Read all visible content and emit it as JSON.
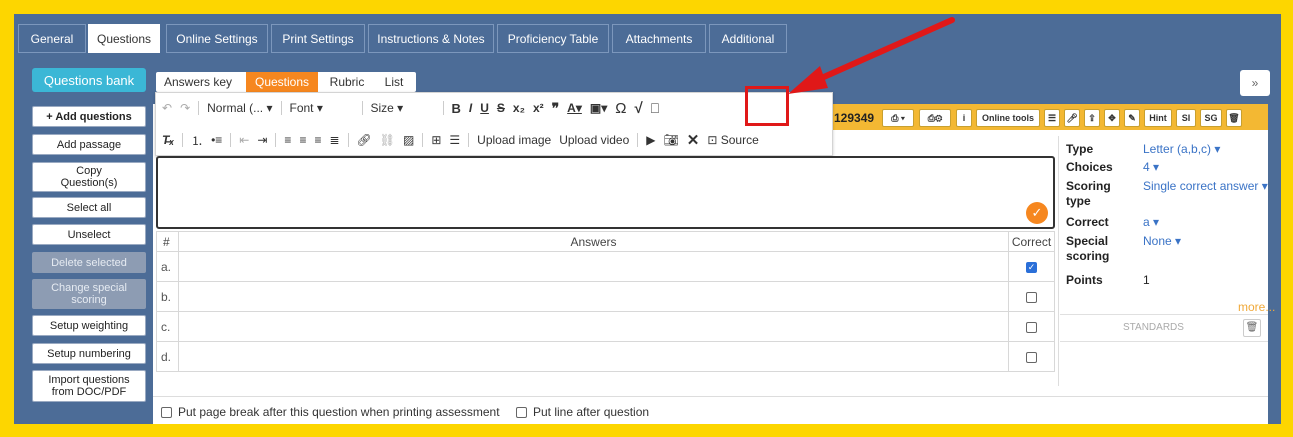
{
  "top_tabs": [
    {
      "label": "General",
      "active": false
    },
    {
      "label": "Questions",
      "active": true
    },
    {
      "label": "Online Settings",
      "active": false
    },
    {
      "label": "Print Settings",
      "active": false
    },
    {
      "label": "Instructions & Notes",
      "active": false
    },
    {
      "label": "Proficiency Table",
      "active": false
    },
    {
      "label": "Attachments",
      "active": false
    },
    {
      "label": "Additional",
      "active": false
    }
  ],
  "sidebar": {
    "questions_bank": "Questions bank",
    "buttons": [
      {
        "label": "+ Add questions",
        "disabled": false
      },
      {
        "label": "Add passage",
        "disabled": false
      },
      {
        "label": "Copy Question(s)",
        "disabled": false
      },
      {
        "label": "Select all",
        "disabled": false
      },
      {
        "label": "Unselect",
        "disabled": false
      },
      {
        "label": "Delete selected",
        "disabled": true
      },
      {
        "label": "Change special scoring",
        "disabled": true
      },
      {
        "label": "Setup weighting",
        "disabled": false
      },
      {
        "label": "Setup numbering",
        "disabled": false
      },
      {
        "label": "Import questions from DOC/PDF",
        "disabled": false
      }
    ]
  },
  "sub_tabs": [
    {
      "label": "Answers key",
      "active": false
    },
    {
      "label": "Questions",
      "active": true
    },
    {
      "label": "Rubric",
      "active": false
    },
    {
      "label": "List",
      "active": false
    }
  ],
  "expand_icon": "»",
  "editor_toolbar": {
    "paragraph_format": "Normal (...",
    "font": "Font",
    "size": "Size",
    "upload_image": "Upload image",
    "upload_video": "Upload video",
    "source": "Source"
  },
  "question": {
    "id_suffix": "129349",
    "tools": [
      "Online tools",
      "Hint",
      "SI",
      "SG"
    ]
  },
  "answers_table": {
    "headers": {
      "num": "#",
      "answers": "Answers",
      "correct": "Correct"
    },
    "rows": [
      {
        "letter": "a.",
        "text": "",
        "correct": true
      },
      {
        "letter": "b.",
        "text": "",
        "correct": false
      },
      {
        "letter": "c.",
        "text": "",
        "correct": false
      },
      {
        "letter": "d.",
        "text": "",
        "correct": false
      }
    ]
  },
  "properties": {
    "type_label": "Type",
    "type_value": "Letter (a,b,c)",
    "choices_label": "Choices",
    "choices_value": "4",
    "scoring_label": "Scoring type",
    "scoring_value": "Single correct answer",
    "correct_label": "Correct",
    "correct_value": "a",
    "special_label": "Special scoring",
    "special_value": "None",
    "points_label": "Points",
    "points_value": "1",
    "more": "more...",
    "standards": "STANDARDS"
  },
  "footer": {
    "page_break": "Put page break after this question when printing assessment",
    "line_after": "Put line after question"
  },
  "colors": {
    "frame": "#fdd600",
    "app_bg": "#4c6c97",
    "accent_orange": "#f6871f",
    "questions_bank": "#3bb7d6",
    "annotation_red": "#e01818"
  }
}
